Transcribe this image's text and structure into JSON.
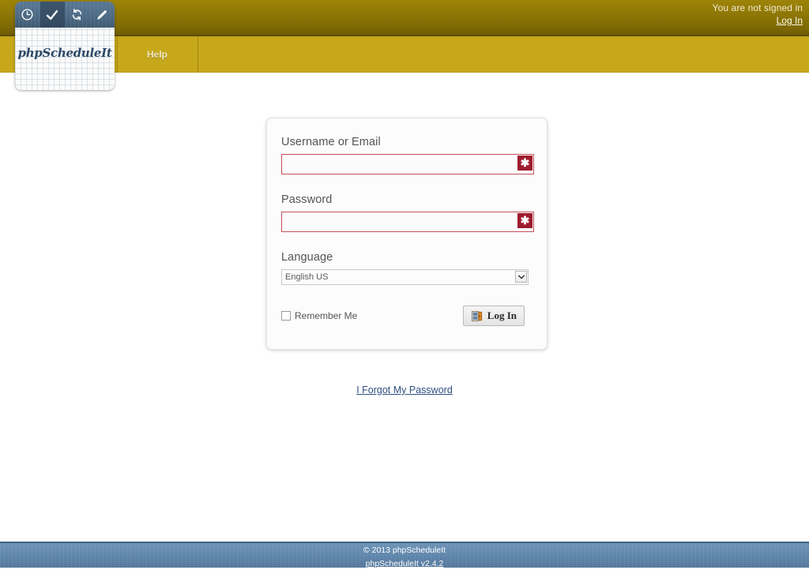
{
  "header": {
    "signed_in_status": "You are not signed in",
    "log_in_link": "Log In",
    "nav_items": [
      {
        "label": "Help",
        "icon": "help-nav-item"
      }
    ]
  },
  "logo": {
    "wordmark": "phpScheduleIt",
    "icons": [
      {
        "name": "clock-icon",
        "active": false
      },
      {
        "name": "check-icon",
        "active": true
      },
      {
        "name": "sync-icon",
        "active": false
      },
      {
        "name": "pencil-icon",
        "active": false
      }
    ]
  },
  "login_form": {
    "username_label": "Username or Email",
    "username_value": "",
    "username_placeholder": "",
    "username_required_marker": "✱",
    "password_label": "Password",
    "password_value": "",
    "password_placeholder": "",
    "password_required_marker": "✱",
    "language_label": "Language",
    "language_selected": "English US",
    "language_options": [
      "English US"
    ],
    "remember_me_label": "Remember Me",
    "remember_me_checked": false,
    "submit_label": "Log In",
    "submit_icon": "door-login-icon"
  },
  "links": {
    "forgot_password": "I Forgot My Password"
  },
  "footer": {
    "copyright": "© 2013 phpScheduleIt",
    "version_link": "phpScheduleIt v2.4.2"
  },
  "colors": {
    "header_gold_dark": "#8d7606",
    "nav_gold": "#c8a81b",
    "required_red": "#9e1b2f",
    "input_border_red": "#c4515a",
    "footer_blue": "#5f86ab",
    "link_blue": "#2f4f7f"
  }
}
